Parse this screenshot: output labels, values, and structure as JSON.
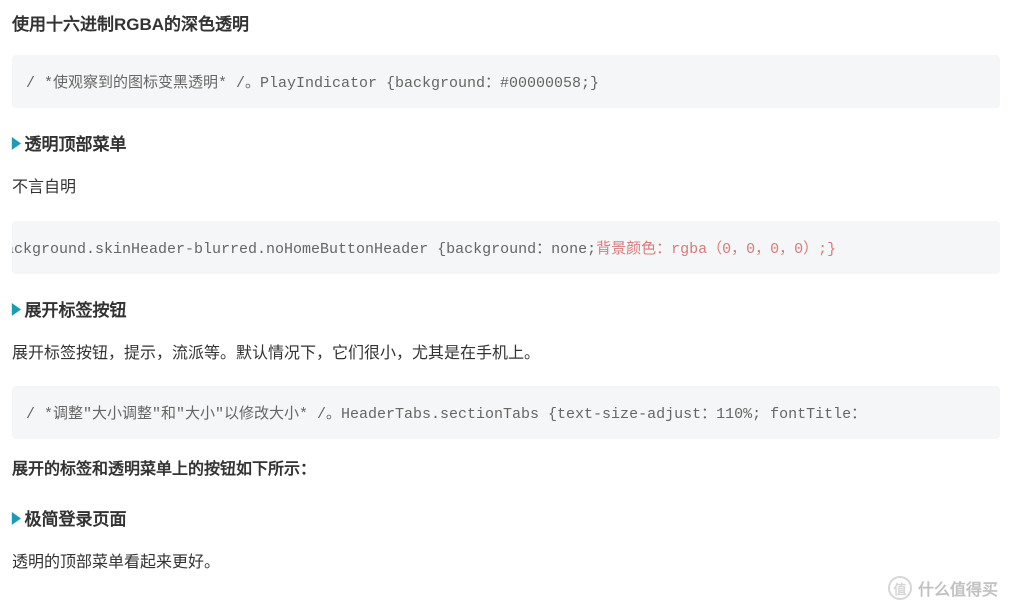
{
  "section1": {
    "heading": "使用十六进制RGBA的深色透明",
    "code": "/ *使观察到的图标变黑透明* /。PlayIndicator {background：#00000058;}"
  },
  "section2": {
    "heading": "透明顶部菜单",
    "paragraph": "不言自明",
    "code_plain": "Background.skinHeader-blurred.noHomeButtonHeader {background：none;",
    "code_pink": "背景颜色：rgba（0，0，0，0）;}"
  },
  "section3": {
    "heading": "展开标签按钮",
    "paragraph": "展开标签按钮，提示，流派等。默认情况下，它们很小，尤其是在手机上。",
    "code": "/ *调整\"大小调整\"和\"大小\"以修改大小* /。HeaderTabs.sectionTabs {text-size-adjust：110%; fontTitle："
  },
  "section4": {
    "paragraph": "展开的标签和透明菜单上的按钮如下所示："
  },
  "section5": {
    "heading": "极简登录页面",
    "paragraph": "透明的顶部菜单看起来更好。"
  },
  "watermark": {
    "icon": "值",
    "text": "什么值得买"
  }
}
